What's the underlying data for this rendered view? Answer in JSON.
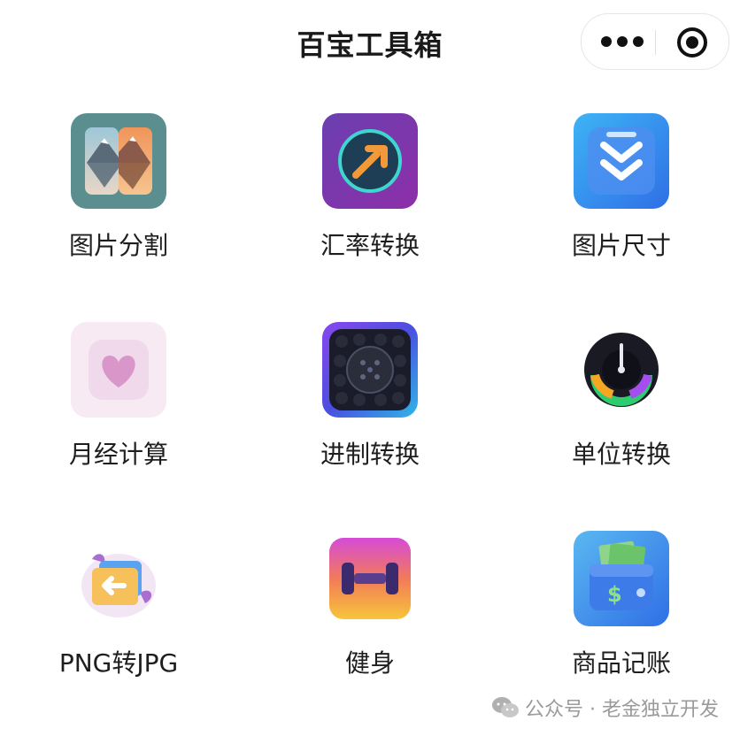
{
  "header": {
    "title": "百宝工具箱",
    "more_icon": "more-dots-icon",
    "close_icon": "target-close-icon"
  },
  "tools": [
    {
      "label": "图片分割",
      "icon": "mountain-split-icon"
    },
    {
      "label": "汇率转换",
      "icon": "exchange-arrow-icon"
    },
    {
      "label": "图片尺寸",
      "icon": "resize-chevrons-icon"
    },
    {
      "label": "月经计算",
      "icon": "heart-icon"
    },
    {
      "label": "进制转换",
      "icon": "number-dial-icon"
    },
    {
      "label": "单位转换",
      "icon": "gauge-icon"
    },
    {
      "label": "PNG转JPG",
      "icon": "image-convert-icon"
    },
    {
      "label": "健身",
      "icon": "dumbbell-icon"
    },
    {
      "label": "商品记账",
      "icon": "wallet-money-icon"
    }
  ],
  "watermark": {
    "text": "公众号 · 老金独立开发",
    "icon": "wechat-icon"
  }
}
